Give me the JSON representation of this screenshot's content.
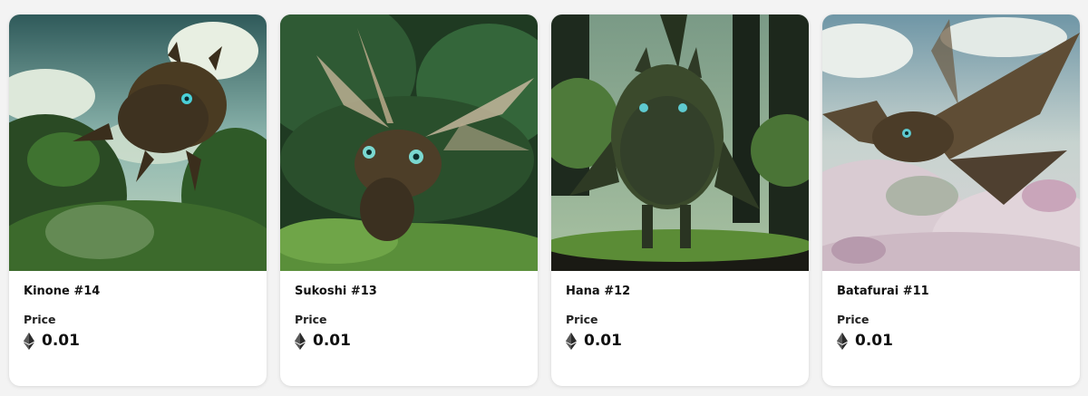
{
  "items": [
    {
      "name": "Kinone #14",
      "price_label": "Price",
      "price_value": "0.01",
      "currency_icon": "ethereum-icon",
      "art": "forest-moss-creature-flying"
    },
    {
      "name": "Sukoshi #13",
      "price_label": "Price",
      "price_value": "0.01",
      "currency_icon": "ethereum-icon",
      "art": "forest-winged-creature"
    },
    {
      "name": "Hana #12",
      "price_label": "Price",
      "price_value": "0.01",
      "currency_icon": "ethereum-icon",
      "art": "forest-moss-creature-standing"
    },
    {
      "name": "Batafurai #11",
      "price_label": "Price",
      "price_value": "0.01",
      "currency_icon": "ethereum-icon",
      "art": "butterfly-creature-over-blossoms"
    }
  ],
  "colors": {
    "card_background": "#ffffff",
    "page_background": "#f3f3f3",
    "text_primary": "#111111"
  }
}
